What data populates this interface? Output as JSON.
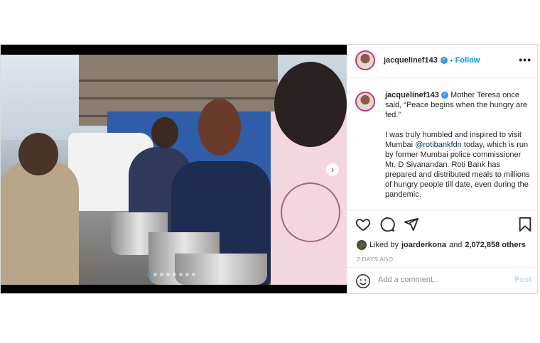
{
  "post": {
    "username": "jacquelinef143",
    "follow_label": "Follow",
    "separator": "•",
    "more_label": "•••",
    "caption_before_mention": "Mother Teresa once said, “Peace begins when the hungry are fed.”\n\nI was truly humbled and inspired to visit Mumbai ",
    "caption_mention": "@rotibankfdn",
    "caption_after_mention": " today, which is run by former Mumbai police commissioner Mr. D Sivanandan. Roti Bank has prepared and distributed meals to millions of hungry people till date, even during the pandemic.",
    "likes_prefix": "Liked by",
    "likes_user": "joarderkona",
    "likes_and": "and",
    "likes_count": "2,072,858 others",
    "time_ago": "2 DAYS AGO",
    "comment_placeholder": "Add a comment...",
    "post_button": "Post",
    "carousel_next": "›",
    "carousel_total": 8,
    "carousel_active": 1
  },
  "colors": {
    "link": "#0095f6",
    "verified": "#3897f0",
    "mention": "#00376b",
    "post_disabled": "#b2dffc"
  },
  "icons": [
    "heart-icon",
    "comment-icon",
    "share-icon",
    "bookmark-icon",
    "emoji-icon",
    "verified-badge-icon",
    "more-icon",
    "chevron-right-icon"
  ]
}
